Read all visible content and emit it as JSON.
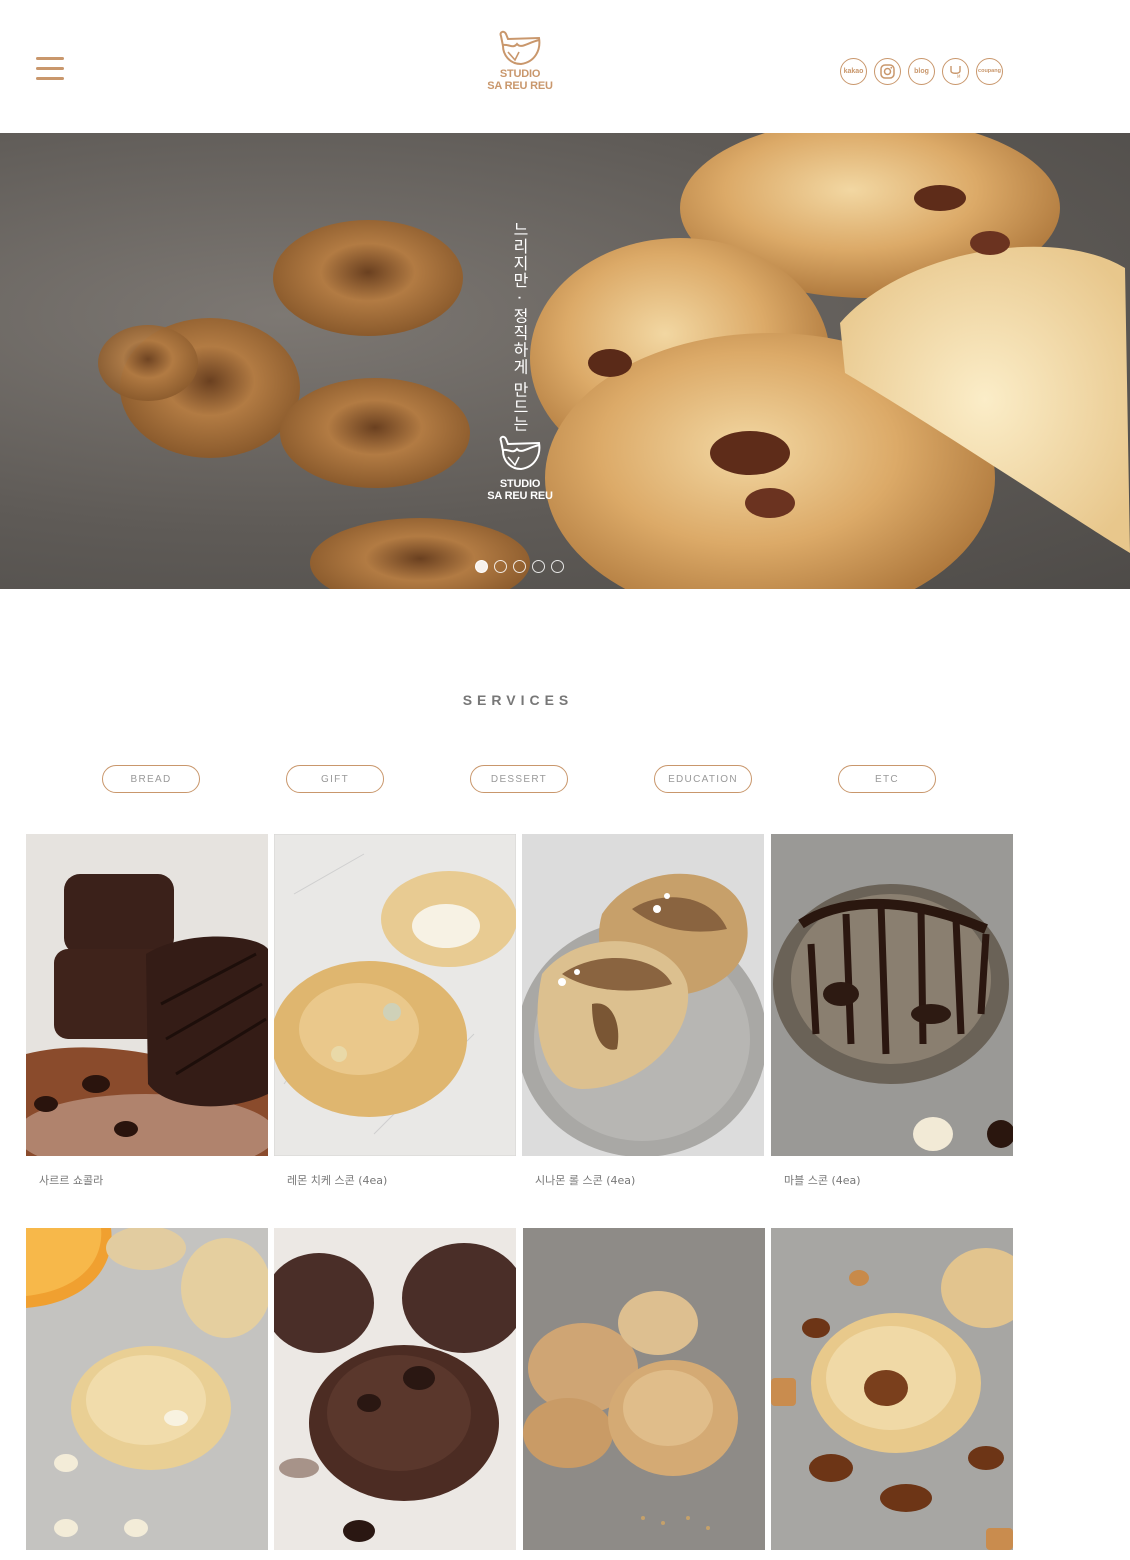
{
  "header": {
    "brand_line1": "STUDIO",
    "brand_line2": "SA REU REU",
    "social_links": [
      {
        "name": "kakao-icon",
        "label": "kakao"
      },
      {
        "name": "instagram-icon",
        "label": ""
      },
      {
        "name": "blog-icon",
        "label": "blog"
      },
      {
        "name": "hm-icon",
        "label": ""
      },
      {
        "name": "coupang-icon",
        "label": "coupang"
      }
    ]
  },
  "hero": {
    "tagline": "느리지만 · 정직하게 만드는",
    "brand_line1": "STUDIO",
    "brand_line2": "SA REU REU",
    "slide_count": 5,
    "active_slide": 1
  },
  "services": {
    "title": "SERVICES",
    "tabs": [
      "BREAD",
      "GIFT",
      "DESSERT",
      "EDUCATION",
      "ETC"
    ],
    "products": [
      {
        "name": "사르르 쇼콜라"
      },
      {
        "name": "레몬 치케 스콘 (4ea)"
      },
      {
        "name": "시나몬 롤 스콘 (4ea)"
      },
      {
        "name": "마블 스콘 (4ea)"
      },
      {
        "name": ""
      },
      {
        "name": ""
      },
      {
        "name": ""
      },
      {
        "name": ""
      }
    ]
  },
  "colors": {
    "accent": "#c9976c",
    "text": "#777777",
    "background": "#ffffff"
  }
}
